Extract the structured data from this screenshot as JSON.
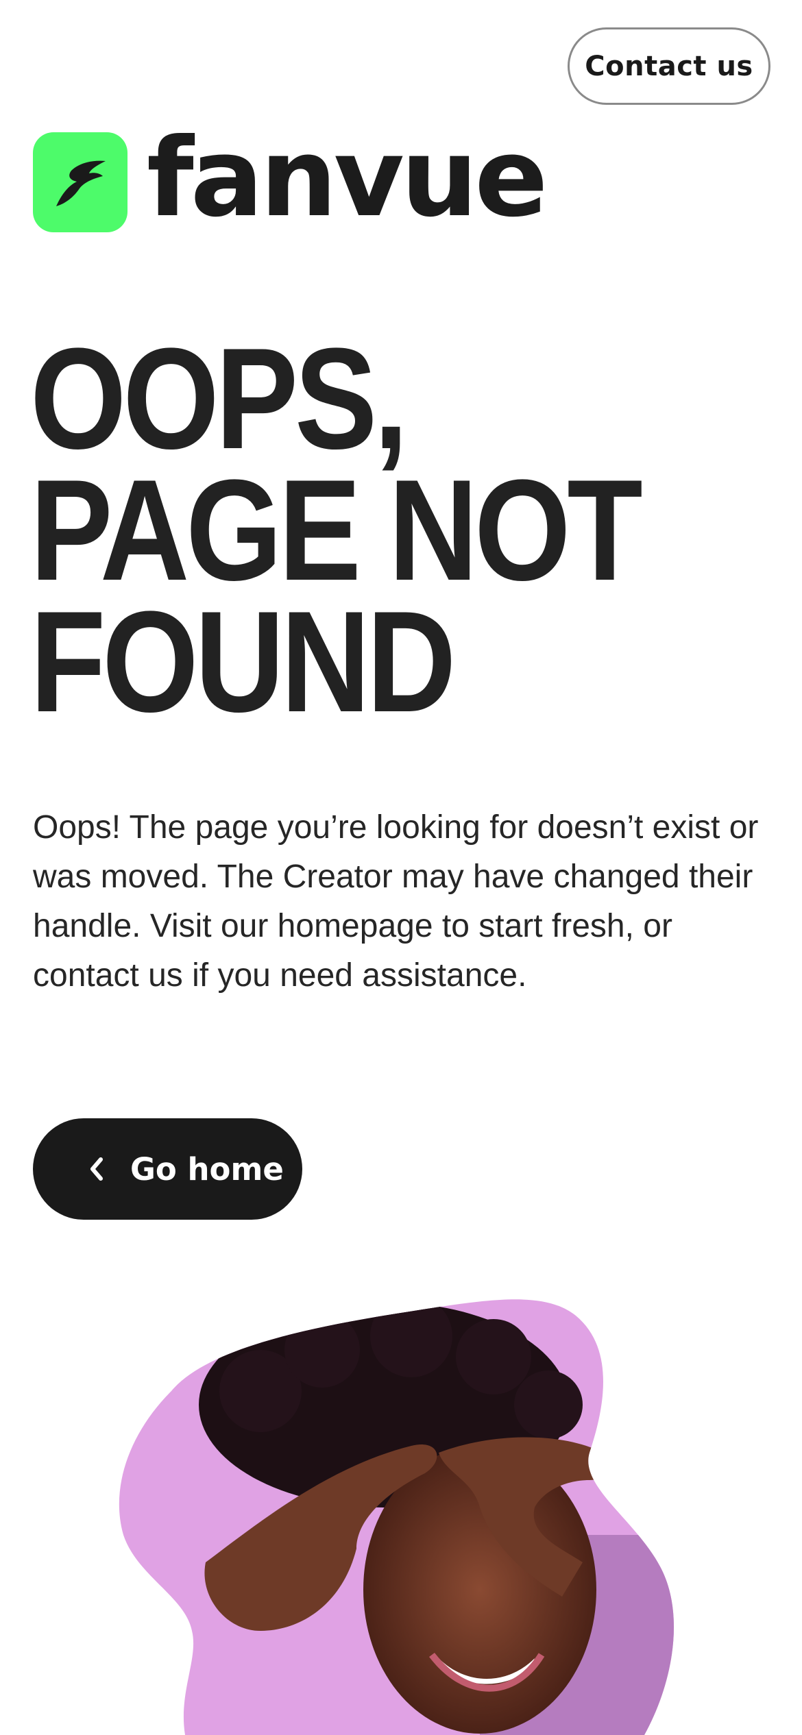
{
  "header": {
    "contact_label": "Contact us"
  },
  "brand": {
    "name": "fanvue",
    "accent_color": "#4dfb6a",
    "icon": "fanvue-logo-icon"
  },
  "error": {
    "headline_lines": [
      "OOPS,",
      "PAGE NOT",
      "FOUND"
    ],
    "description": "Oops! The page you’re looking for doesn’t exist or was moved. The Creator may have changed their handle. Visit our homepage to start fresh, or contact us if you need assistance."
  },
  "actions": {
    "go_home_label": "Go home",
    "go_home_icon": "chevron-left-icon"
  },
  "hero": {
    "image": "smiling-woman-portrait-photo",
    "background_color": "#e0a2e4"
  }
}
